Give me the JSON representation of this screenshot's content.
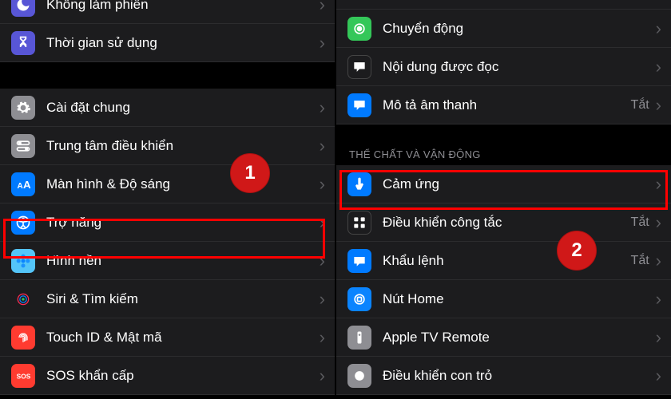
{
  "left": {
    "items": [
      {
        "label": "Không làm phiền"
      },
      {
        "label": "Thời gian sử dụng"
      }
    ],
    "group2": [
      {
        "label": "Cài đặt chung"
      },
      {
        "label": "Trung tâm điều khiển"
      },
      {
        "label": "Màn hình & Độ sáng"
      },
      {
        "label": "Trợ năng"
      },
      {
        "label": "Hình nền"
      },
      {
        "label": "Siri & Tìm kiếm"
      },
      {
        "label": "Touch ID & Mật mã"
      },
      {
        "label": "SOS khẩn cấp"
      }
    ]
  },
  "right": {
    "top": [
      {
        "label": "Chuyển động"
      },
      {
        "label": "Nội dung được đọc"
      },
      {
        "label": "Mô tả âm thanh",
        "value": "Tắt"
      }
    ],
    "section_header": "THỂ CHẤT VÀ VẬN ĐỘNG",
    "physical": [
      {
        "label": "Cảm ứng"
      },
      {
        "label": "Điều khiển công tắc",
        "value": "Tắt"
      },
      {
        "label": "Khẩu lệnh",
        "value": "Tắt"
      },
      {
        "label": "Nút Home"
      },
      {
        "label": "Apple TV Remote"
      },
      {
        "label": "Điều khiển con trỏ"
      }
    ]
  },
  "badges": {
    "one": "1",
    "two": "2"
  },
  "colors": {
    "purple": "#5856d6",
    "blue": "#007aff",
    "grey": "#8e8e93",
    "green": "#34c759",
    "teal": "#0bb5a8",
    "orange": "#ff3b30",
    "red": "#ff2d2d",
    "black": "#1c1c1e",
    "greyIcon": "#636366",
    "blueBright": "#0a84ff"
  }
}
